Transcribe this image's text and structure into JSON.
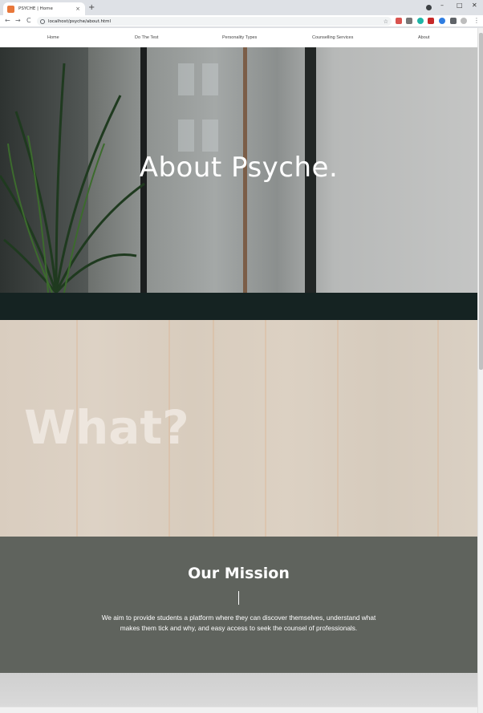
{
  "browser": {
    "tab_title": "PSYCHE | Home",
    "tab_close": "×",
    "new_tab": "+",
    "url": "localhost/psyche/about.html",
    "back": "←",
    "forward": "→",
    "reload": "C",
    "star": "☆",
    "minimize": "–",
    "maximize": "□",
    "close": "✕",
    "menu": "⋮"
  },
  "nav": {
    "items": [
      "Home",
      "Do The Test",
      "Personality Types",
      "Counselling Services",
      "About"
    ]
  },
  "hero": {
    "title": "About Psyche."
  },
  "what": {
    "title": "What?"
  },
  "mission": {
    "title": "Our Mission",
    "text": "We aim to provide students a platform where they can discover themselves, understand what makes them tick and why, and easy access to seek the counsel of professionals."
  },
  "colors": {
    "dark_band": "#152322",
    "mission_bg": "#5f635d",
    "what_bg": "#d9cdbf"
  }
}
